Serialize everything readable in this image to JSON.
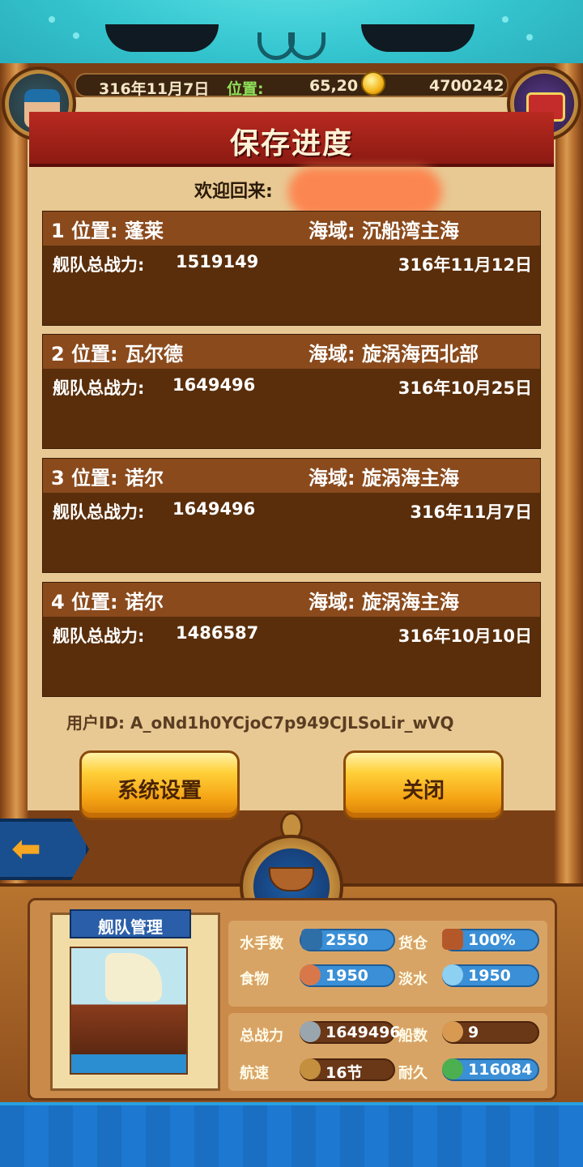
{
  "hud": {
    "date": "316年11月7日",
    "position_label": "位置:",
    "position_value": "65,20",
    "gold": "4700242"
  },
  "title": "保存进度",
  "welcome": "欢迎回来:",
  "slots": [
    {
      "location": "1 位置: 蓬莱",
      "sea": "海域: 沉船湾主海",
      "power_label": "舰队总战力:",
      "power": "1519149",
      "date": "316年11月12日"
    },
    {
      "location": "2 位置: 瓦尔德",
      "sea": "海域: 旋涡海西北部",
      "power_label": "舰队总战力:",
      "power": "1649496",
      "date": "316年10月25日"
    },
    {
      "location": "3 位置: 诺尔",
      "sea": "海域: 旋涡海主海",
      "power_label": "舰队总战力:",
      "power": "1649496",
      "date": "316年11月7日"
    },
    {
      "location": "4 位置: 诺尔",
      "sea": "海域: 旋涡海主海",
      "power_label": "舰队总战力:",
      "power": "1486587",
      "date": "316年10月10日"
    }
  ],
  "user_id": "用户ID: A_oNd1h0YCjoC7p949CJLSoLir_wVQ",
  "buttons": {
    "settings": "系统设置",
    "close": "关闭",
    "back_icon": "arrow-left-icon"
  },
  "fleet": {
    "title": "舰队管理",
    "sailors_label": "水手数",
    "sailors": "2550",
    "cargo_label": "货仓",
    "cargo": "100%",
    "food_label": "食物",
    "food": "1950",
    "water_label": "淡水",
    "water": "1950",
    "power_label": "总战力",
    "power": "1649496",
    "ships_label": "船数",
    "ships": "9",
    "speed_label": "航速",
    "speed": "16节",
    "durability_label": "耐久",
    "durability": "116084"
  },
  "colors": {
    "title_red": "#b82a20",
    "slot_bg": "#5a2e0b",
    "slot_head": "#8a4a1c",
    "button_gold": "#ffd03a",
    "pill_blue": "#3a8fd6"
  }
}
